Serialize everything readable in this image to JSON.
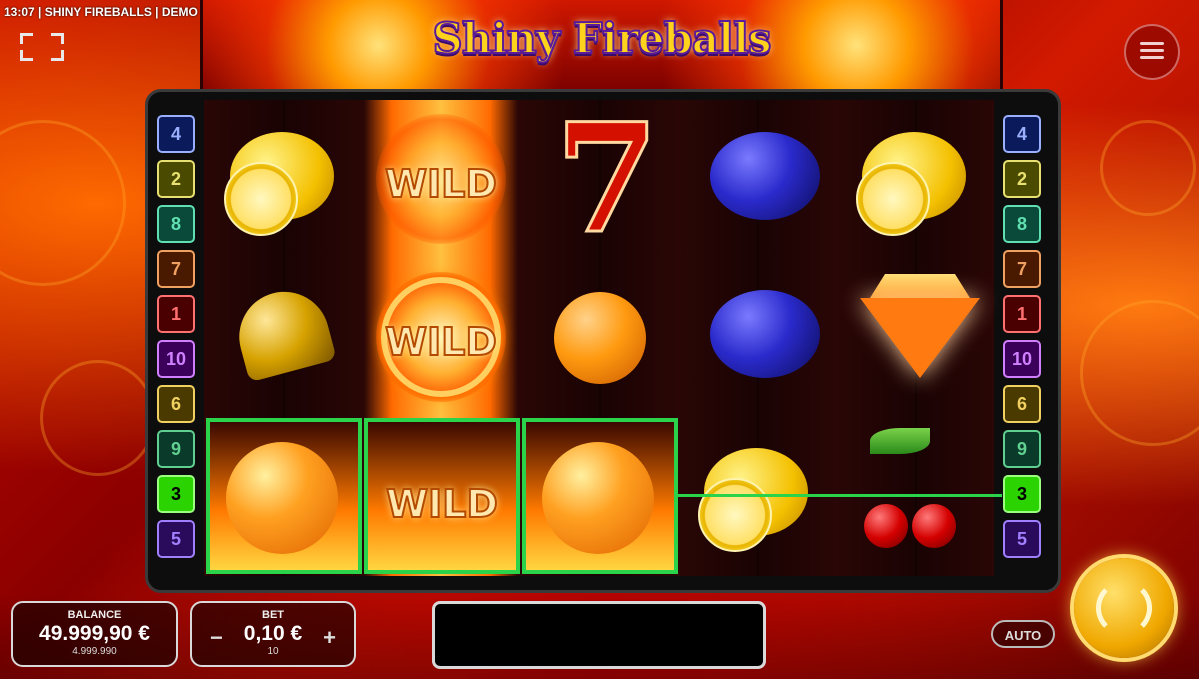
{
  "status_bar": {
    "text": "13:07 | SHINY FIREBALLS | DEMO"
  },
  "header": {
    "title": "Shiny Fireballs"
  },
  "paylines_left": [
    "4",
    "2",
    "8",
    "7",
    "1",
    "10",
    "6",
    "9",
    "3",
    "5"
  ],
  "paylines_right": [
    "4",
    "2",
    "8",
    "7",
    "1",
    "10",
    "6",
    "9",
    "3",
    "5"
  ],
  "active_payline": "3",
  "reels": {
    "wild_label": "WILD",
    "grid": [
      [
        "lemon",
        "wild",
        "seven",
        "plum",
        "lemon"
      ],
      [
        "bell",
        "wild",
        "orange",
        "plum",
        "diamond"
      ],
      [
        "orange",
        "wild",
        "orange",
        "lemon",
        "cherry"
      ]
    ],
    "winning_cells": [
      [
        2,
        0
      ],
      [
        2,
        1
      ],
      [
        2,
        2
      ]
    ]
  },
  "balance": {
    "label": "BALANCE",
    "value": "49.999,90 €",
    "credits": "4.999.990"
  },
  "bet": {
    "label": "BET",
    "value": "0,10 €",
    "credits": "10",
    "minus": "−",
    "plus": "+"
  },
  "auto_label": "AUTO",
  "icons": {
    "fullscreen": "fullscreen-icon",
    "menu": "hamburger-menu-icon",
    "spin": "spin-arrows-icon"
  },
  "colors": {
    "win_highlight": "#2bd34a",
    "title_gold": "#ffd21c",
    "spin_gold": "#f0a800"
  }
}
